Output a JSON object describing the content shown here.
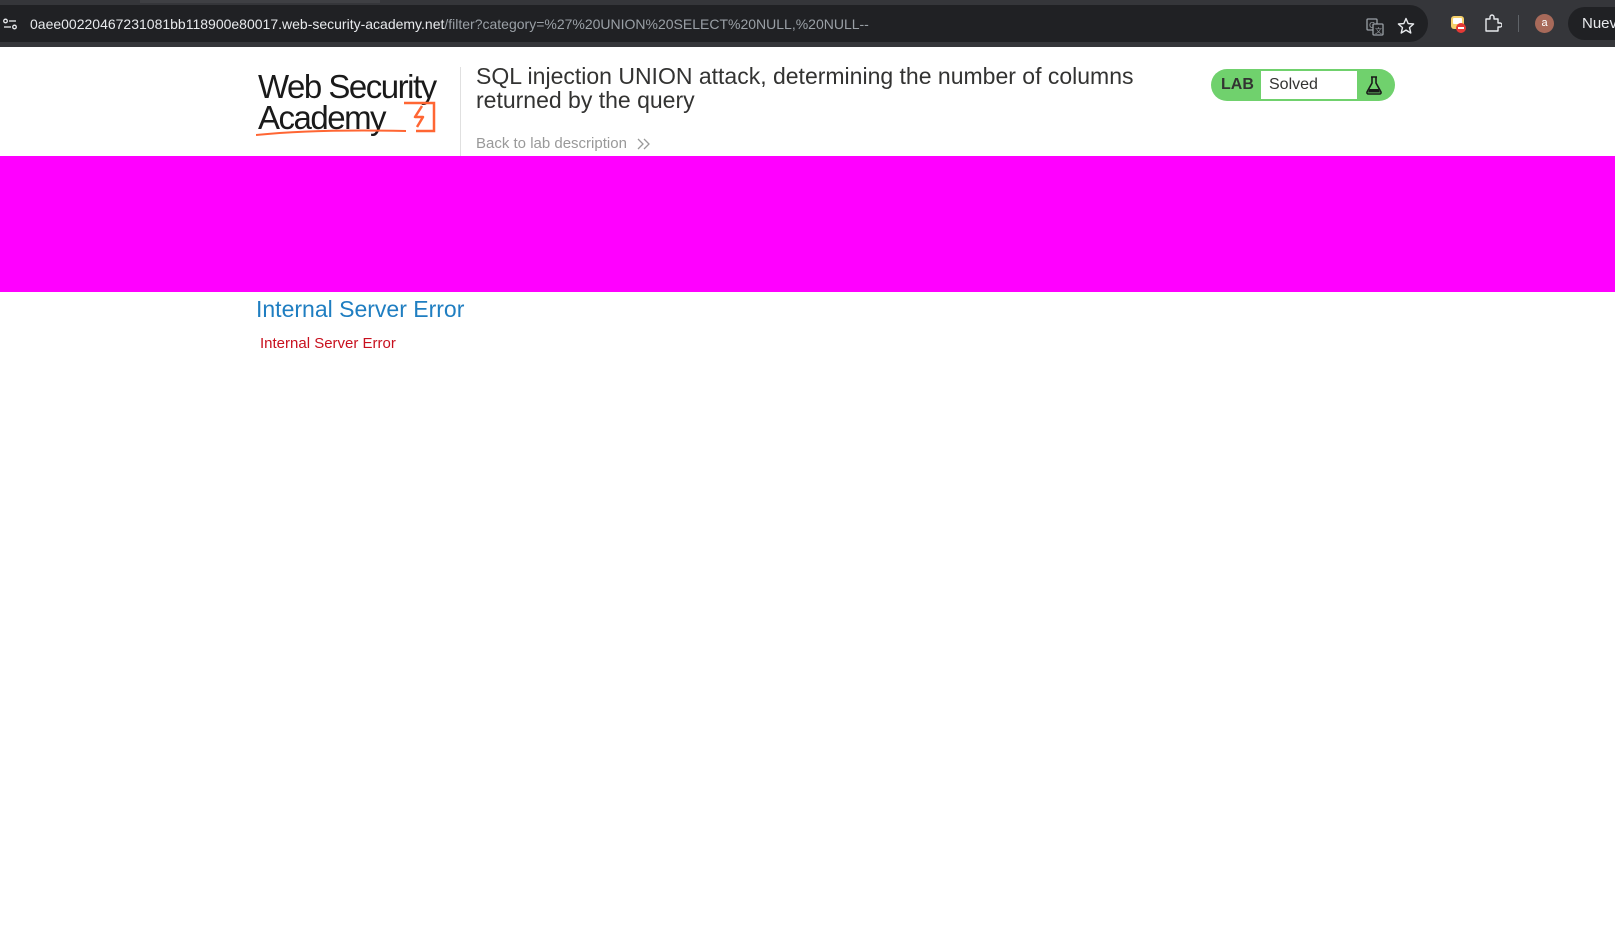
{
  "browser": {
    "url_host": "0aee00220467231081bb118900e80017.web-security-academy.net",
    "url_path": "/filter?category=%27%20UNION%20SELECT%20NULL,%20NULL--",
    "avatar_letter": "a",
    "profile_chip_label": "Nuev",
    "icons": [
      "site-info-icon",
      "translate-icon",
      "star-icon",
      "extension-blocker-icon",
      "puzzle-icon"
    ]
  },
  "header": {
    "logo_line1": "Web Security",
    "logo_line2": "Academy",
    "title": "SQL injection UNION attack, determining the number of columns returned by the query",
    "back_link": "Back to lab description",
    "status_label": "LAB",
    "status_value": "Solved",
    "status_color": "#70d16d"
  },
  "banner": {
    "color": "#ff00ff"
  },
  "main": {
    "heading": "Internal Server Error",
    "message": "Internal Server Error"
  },
  "colors": {
    "heading": "#1f7ec1",
    "error_text": "#c8101e",
    "logo_accent": "#ff6633"
  }
}
